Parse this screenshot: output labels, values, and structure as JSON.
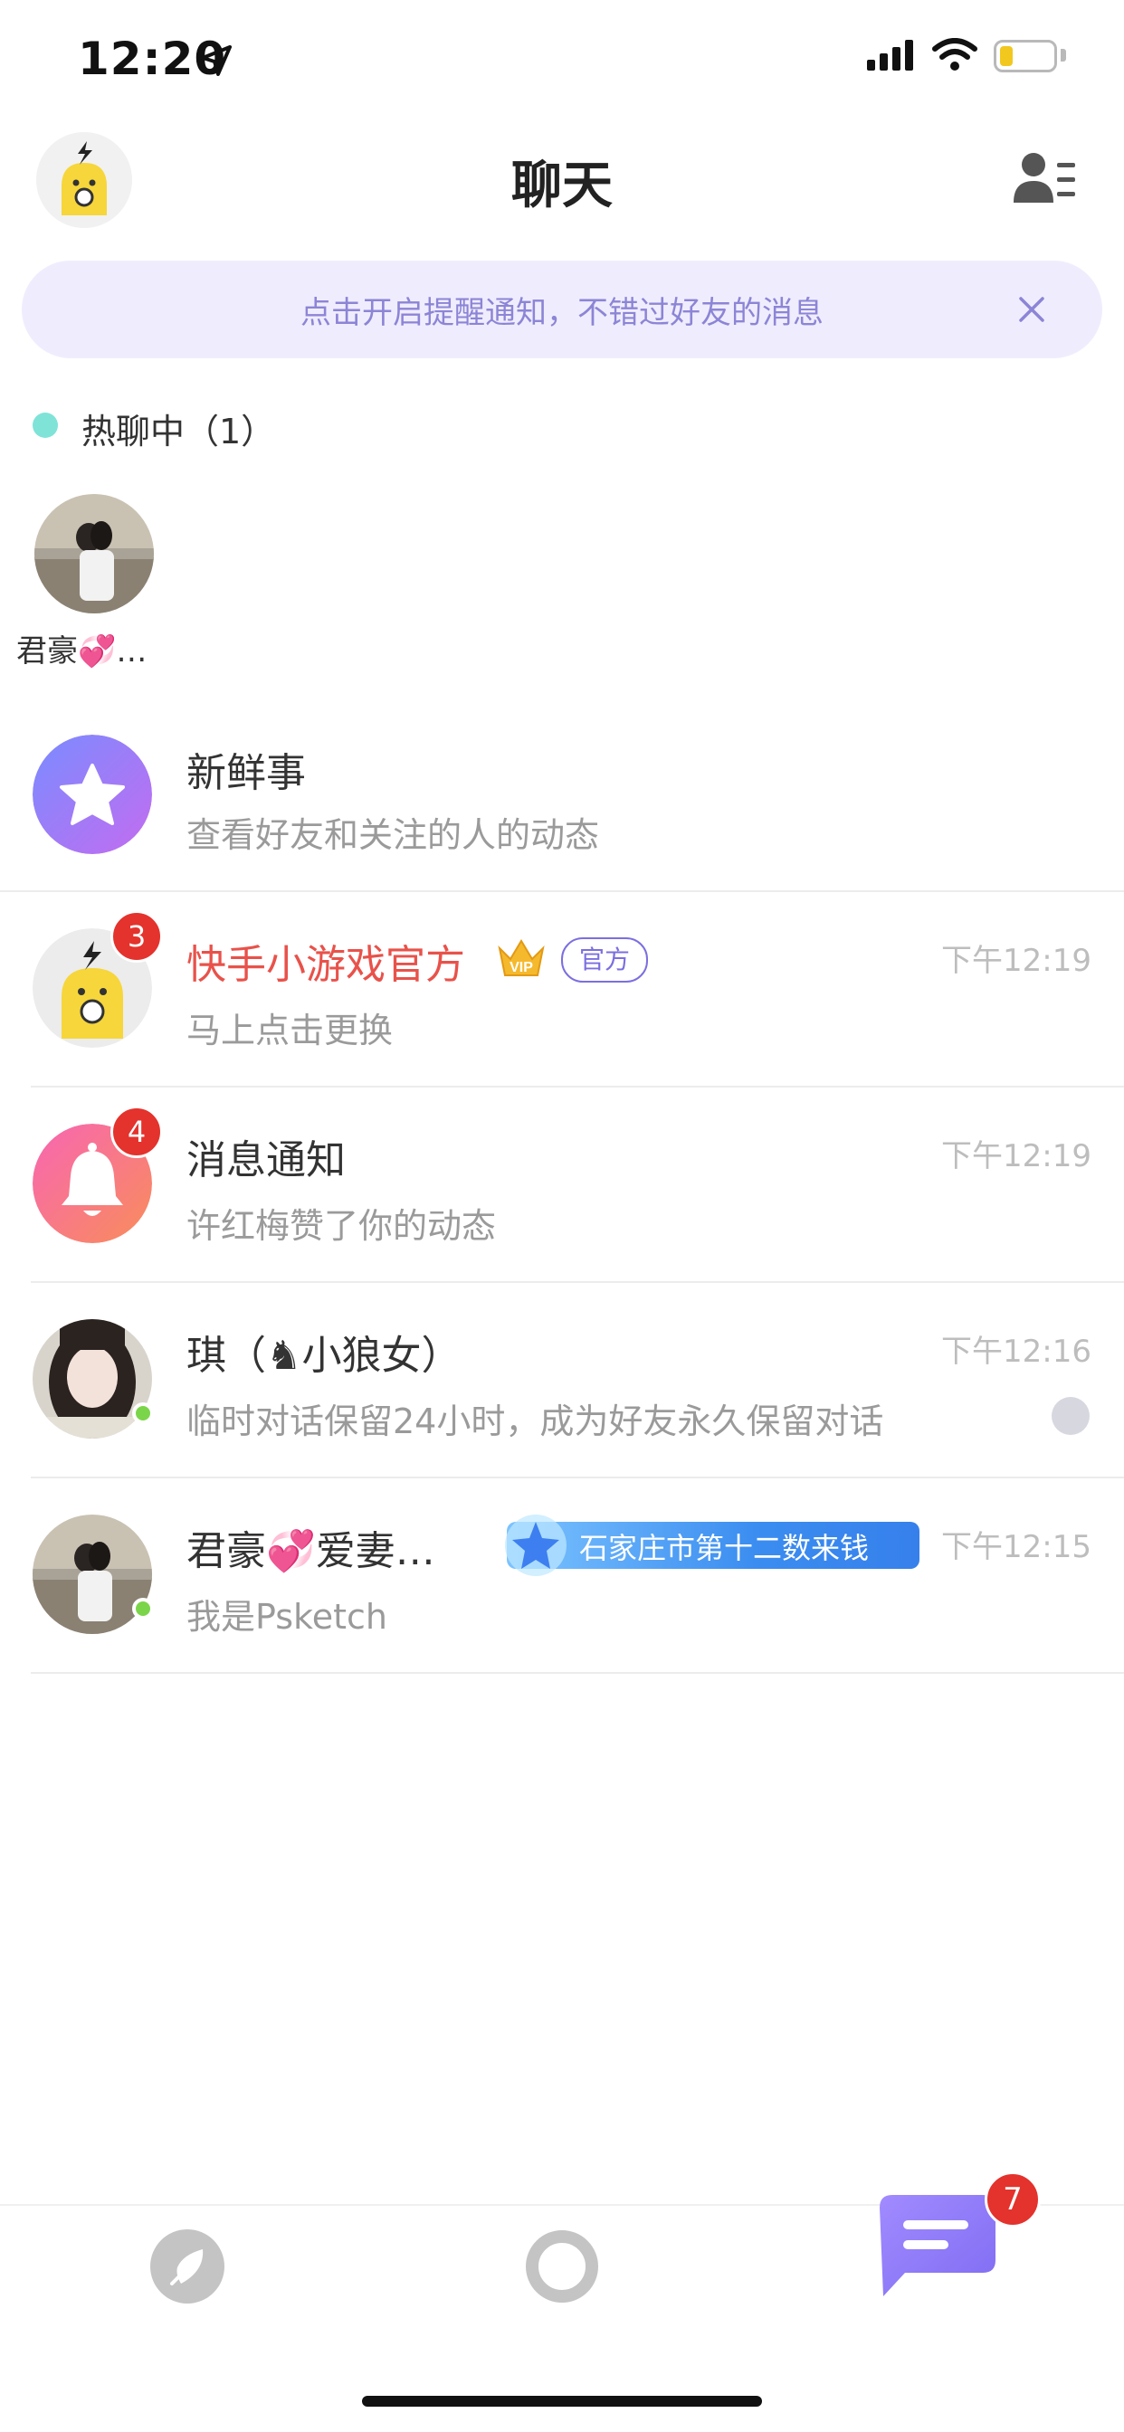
{
  "status_bar": {
    "time": "12:20"
  },
  "header": {
    "title": "聊天"
  },
  "notice": {
    "text": "点击开启提醒通知，不错过好友的消息"
  },
  "hot_chats": {
    "label": "热聊中（1）",
    "items": [
      {
        "name": "君豪💞…"
      }
    ]
  },
  "conversations": [
    {
      "title": "新鲜事",
      "subtitle": "查看好友和关注的人的动态"
    },
    {
      "title": "快手小游戏官方",
      "tag": "官方",
      "subtitle": "马上点击更换",
      "time": "下午12:19",
      "badge": "3",
      "title_color": "#e8524a"
    },
    {
      "title": "消息通知",
      "subtitle": "许红梅赞了你的动态",
      "time": "下午12:19",
      "badge": "4"
    },
    {
      "title": "琪（♞小狼女）",
      "subtitle": "临时对话保留24小时，成为好友永久保留对话",
      "time": "下午12:16"
    },
    {
      "title": "君豪💞爱妻…",
      "tag": "石家庄市第十二数来钱",
      "subtitle": "我是Psketch",
      "time": "下午12:15"
    }
  ],
  "tabbar": {
    "message_badge": "7"
  },
  "colors": {
    "accent": "#8c7ff0",
    "badge": "#e4322c",
    "online": "#7bd54a"
  }
}
